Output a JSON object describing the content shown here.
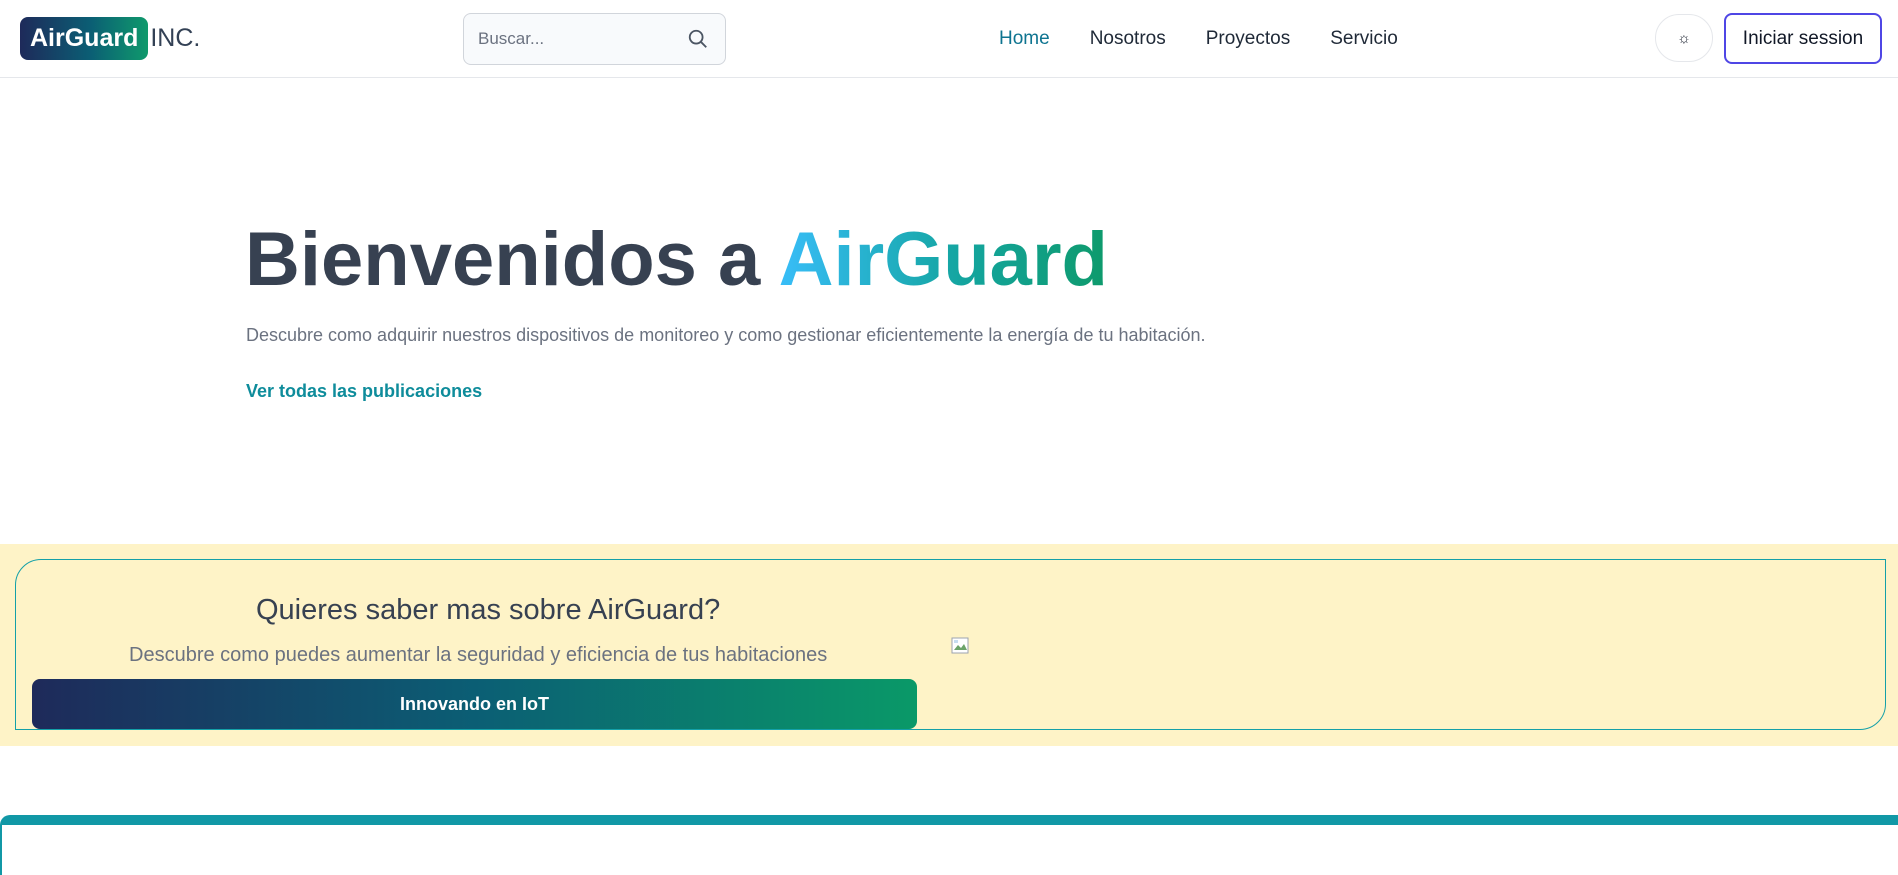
{
  "header": {
    "logo": {
      "badge_text": "AirGuard",
      "suffix_text": "INC."
    },
    "search": {
      "placeholder": "Buscar...",
      "icon": "search-icon"
    },
    "nav": [
      {
        "label": "Home",
        "active": true
      },
      {
        "label": "Nosotros",
        "active": false
      },
      {
        "label": "Proyectos",
        "active": false
      },
      {
        "label": "Servicio",
        "active": false
      }
    ],
    "theme_toggle": {
      "icon": "sun-icon",
      "glyph": "☼"
    },
    "login_label": "Iniciar session"
  },
  "hero": {
    "title_prefix": "Bienvenidos a ",
    "title_brand": "AirGuard",
    "subtitle": "Descubre como adquirir nuestros dispositivos de monitoreo y como gestionar eficientemente la energía de tu habitación.",
    "link_label": "Ver todas las publicaciones"
  },
  "promo": {
    "title": "Quieres saber mas sobre AirGuard?",
    "description": "Descubre como puedes aumentar la seguridad y eficiencia de tus habitaciones",
    "button_label": "Innovando en IoT",
    "image_icon": "broken-image-icon"
  },
  "colors": {
    "primary_teal": "#0e7490",
    "link_teal": "#0e8c9b",
    "login_border": "#4f46e5",
    "promo_bg": "#fef3c7",
    "gradient_start": "#1e2a5a",
    "gradient_end": "#0a9968"
  }
}
